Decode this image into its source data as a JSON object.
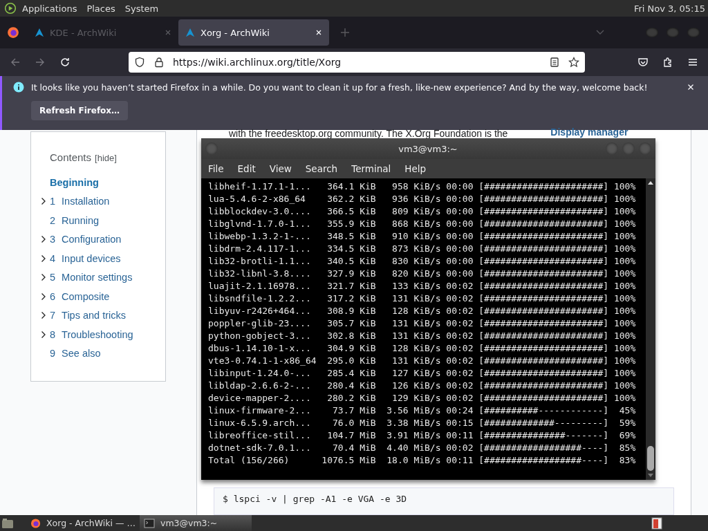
{
  "top_panel": {
    "menus": [
      "Applications",
      "Places",
      "System"
    ],
    "clock": "Fri Nov 3, 05:15"
  },
  "browser": {
    "tabs": [
      {
        "title": "KDE - ArchWiki",
        "selected": false
      },
      {
        "title": "Xorg - ArchWiki",
        "selected": true
      }
    ],
    "url": "https://wiki.archlinux.org/title/Xorg",
    "notification": {
      "message": "It looks like you haven’t started Firefox in a while. Do you want to clean it up for a fresh, like-new experience? And by the way, welcome back!",
      "button": "Refresh Firefox…"
    }
  },
  "page": {
    "contents": {
      "title": "Contents",
      "hide": "[hide]",
      "items": [
        {
          "label": "Beginning",
          "selected": true,
          "collapsible": false
        },
        {
          "number": "1",
          "label": "Installation",
          "selected": false,
          "collapsible": true
        },
        {
          "number": "2",
          "label": "Running",
          "selected": false,
          "collapsible": false
        },
        {
          "number": "3",
          "label": "Configuration",
          "selected": false,
          "collapsible": true
        },
        {
          "number": "4",
          "label": "Input devices",
          "selected": false,
          "collapsible": true
        },
        {
          "number": "5",
          "label": "Monitor settings",
          "selected": false,
          "collapsible": true
        },
        {
          "number": "6",
          "label": "Composite",
          "selected": false,
          "collapsible": true
        },
        {
          "number": "7",
          "label": "Tips and tricks",
          "selected": false,
          "collapsible": true
        },
        {
          "number": "8",
          "label": "Troubleshooting",
          "selected": false,
          "collapsible": true
        },
        {
          "number": "9",
          "label": "See also",
          "selected": false,
          "collapsible": false
        }
      ]
    },
    "article_text": "with the freedesktop.org community. The X.Org Foundation is the",
    "side_link": "Display manager",
    "code": "$ lspci -v | grep -A1 -e VGA -e 3D"
  },
  "terminal": {
    "title": "vm3@vm3:~",
    "menus": [
      "File",
      "Edit",
      "View",
      "Search",
      "Terminal",
      "Help"
    ],
    "rows": [
      {
        "name": "libheif-1.17.1-1...",
        "size": "364.1 KiB",
        "speed": "958 KiB/s",
        "time": "00:00",
        "bar": "[######################]",
        "percent": "100%"
      },
      {
        "name": "lua-5.4.6-2-x86_64",
        "size": "362.2 KiB",
        "speed": "936 KiB/s",
        "time": "00:00",
        "bar": "[######################]",
        "percent": "100%"
      },
      {
        "name": "libblockdev-3.0....",
        "size": "366.5 KiB",
        "speed": "809 KiB/s",
        "time": "00:00",
        "bar": "[######################]",
        "percent": "100%"
      },
      {
        "name": "libglvnd-1.7.0-1...",
        "size": "355.9 KiB",
        "speed": "868 KiB/s",
        "time": "00:00",
        "bar": "[######################]",
        "percent": "100%"
      },
      {
        "name": "libwebp-1.3.2-1-...",
        "size": "348.5 KiB",
        "speed": "910 KiB/s",
        "time": "00:00",
        "bar": "[######################]",
        "percent": "100%"
      },
      {
        "name": "libdrm-2.4.117-1...",
        "size": "334.5 KiB",
        "speed": "873 KiB/s",
        "time": "00:00",
        "bar": "[######################]",
        "percent": "100%"
      },
      {
        "name": "lib32-brotli-1.1...",
        "size": "340.5 KiB",
        "speed": "830 KiB/s",
        "time": "00:00",
        "bar": "[######################]",
        "percent": "100%"
      },
      {
        "name": "lib32-libnl-3.8....",
        "size": "327.9 KiB",
        "speed": "820 KiB/s",
        "time": "00:00",
        "bar": "[######################]",
        "percent": "100%"
      },
      {
        "name": "luajit-2.1.16978...",
        "size": "321.7 KiB",
        "speed": "133 KiB/s",
        "time": "00:02",
        "bar": "[######################]",
        "percent": "100%"
      },
      {
        "name": "libsndfile-1.2.2...",
        "size": "317.2 KiB",
        "speed": "131 KiB/s",
        "time": "00:02",
        "bar": "[######################]",
        "percent": "100%"
      },
      {
        "name": "libyuv-r2426+464...",
        "size": "308.9 KiB",
        "speed": "128 KiB/s",
        "time": "00:02",
        "bar": "[######################]",
        "percent": "100%"
      },
      {
        "name": "poppler-glib-23....",
        "size": "305.7 KiB",
        "speed": "131 KiB/s",
        "time": "00:02",
        "bar": "[######################]",
        "percent": "100%"
      },
      {
        "name": "python-gobject-3...",
        "size": "302.8 KiB",
        "speed": "131 KiB/s",
        "time": "00:02",
        "bar": "[######################]",
        "percent": "100%"
      },
      {
        "name": "dbus-1.14.10-1-x...",
        "size": "304.9 KiB",
        "speed": "128 KiB/s",
        "time": "00:02",
        "bar": "[######################]",
        "percent": "100%"
      },
      {
        "name": "vte3-0.74.1-1-x86_64",
        "size": "295.0 KiB",
        "speed": "131 KiB/s",
        "time": "00:02",
        "bar": "[######################]",
        "percent": "100%"
      },
      {
        "name": "libinput-1.24.0-...",
        "size": "285.4 KiB",
        "speed": "127 KiB/s",
        "time": "00:02",
        "bar": "[######################]",
        "percent": "100%"
      },
      {
        "name": "libldap-2.6.6-2-...",
        "size": "280.4 KiB",
        "speed": "126 KiB/s",
        "time": "00:02",
        "bar": "[######################]",
        "percent": "100%"
      },
      {
        "name": "device-mapper-2....",
        "size": "280.2 KiB",
        "speed": "129 KiB/s",
        "time": "00:02",
        "bar": "[######################]",
        "percent": "100%"
      },
      {
        "name": "linux-firmware-2...",
        "size": "73.7 MiB",
        "speed": "3.56 MiB/s",
        "time": "00:24",
        "bar": "[##########------------]",
        "percent": "45%"
      },
      {
        "name": "linux-6.5.9.arch...",
        "size": "76.0 MiB",
        "speed": "3.38 MiB/s",
        "time": "00:15",
        "bar": "[#############---------]",
        "percent": "59%"
      },
      {
        "name": "libreoffice-stil...",
        "size": "104.7 MiB",
        "speed": "3.91 MiB/s",
        "time": "00:11",
        "bar": "[###############-------]",
        "percent": "69%"
      },
      {
        "name": "dotnet-sdk-7.0.1...",
        "size": "70.4 MiB",
        "speed": "4.40 MiB/s",
        "time": "00:02",
        "bar": "[##################----]",
        "percent": "85%"
      },
      {
        "name": "Total (156/266)",
        "size": "1076.5 MiB",
        "speed": "18.0 MiB/s",
        "time": "00:11",
        "bar": "[##################----]",
        "percent": "83%"
      }
    ]
  },
  "taskbar": {
    "items": [
      {
        "label": "Xorg - ArchWiki — …",
        "kind": "browser",
        "selected": false
      },
      {
        "label": "vm3@vm3:~",
        "kind": "terminal",
        "selected": true
      }
    ]
  }
}
